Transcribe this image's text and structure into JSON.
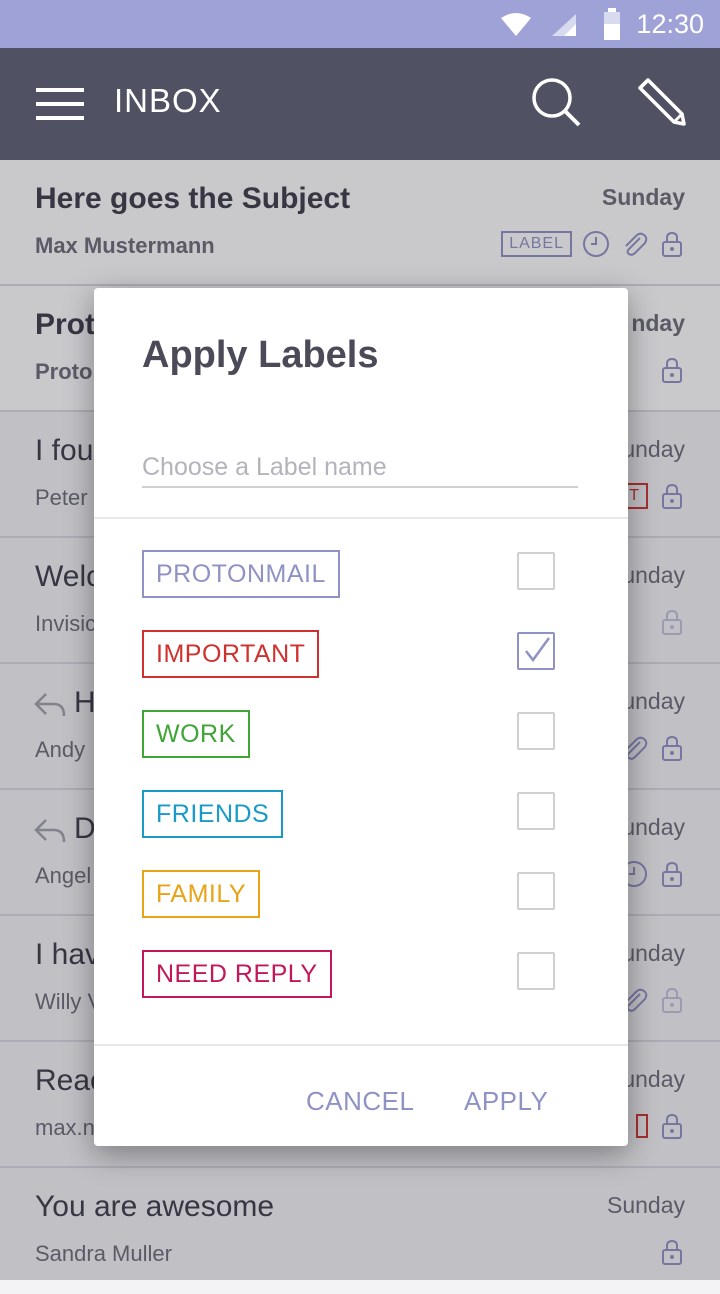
{
  "status_bar": {
    "time": "12:30"
  },
  "app_bar": {
    "title": "INBOX"
  },
  "messages": [
    {
      "subject": "Here goes the Subject",
      "sender": "Max Mustermann",
      "date": "Sunday",
      "label": "LABEL",
      "unread": true
    },
    {
      "subject": "Prot",
      "sender": "Proto",
      "date": "nday",
      "unread": true
    },
    {
      "subject": "I fou",
      "sender": "Peter",
      "date": "unday",
      "label": "NT",
      "unread": false
    },
    {
      "subject": "Welc",
      "sender": "Invisic",
      "date": "unday",
      "unread": false
    },
    {
      "subject": "H",
      "sender": "Andy",
      "date": "unday",
      "unread": false
    },
    {
      "subject": "D",
      "sender": "Angel",
      "date": "unday",
      "unread": false
    },
    {
      "subject": "I hav",
      "sender": "Willy V",
      "date": "unday",
      "unread": false
    },
    {
      "subject": "Reac",
      "sender": "max.n",
      "date": "unday",
      "unread": false
    },
    {
      "subject": "You are awesome",
      "sender": "Sandra Muller",
      "date": "Sunday",
      "unread": false
    }
  ],
  "dialog": {
    "title": "Apply Labels",
    "input_placeholder": "Choose a Label name",
    "labels": [
      {
        "name": "PROTONMAIL",
        "color": "#8f92c4",
        "checked": false
      },
      {
        "name": "IMPORTANT",
        "color": "#d0312d",
        "checked": true
      },
      {
        "name": "WORK",
        "color": "#3fa535",
        "checked": false
      },
      {
        "name": "FRIENDS",
        "color": "#1a9bc7",
        "checked": false
      },
      {
        "name": "FAMILY",
        "color": "#e8a317",
        "checked": false
      },
      {
        "name": "NEED REPLY",
        "color": "#c2185b",
        "checked": false
      }
    ],
    "cancel_label": "CANCEL",
    "apply_label": "APPLY"
  }
}
